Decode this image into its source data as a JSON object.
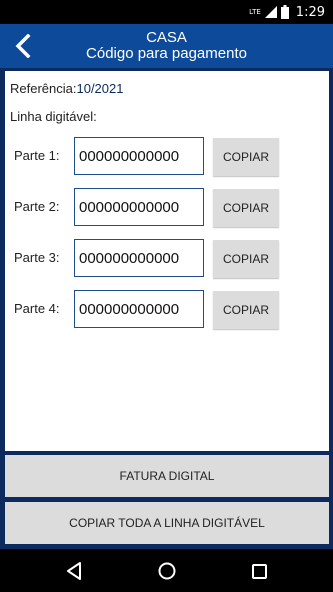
{
  "status_bar": {
    "network": "LTE",
    "time": "1:29"
  },
  "header": {
    "title": "CASA",
    "subtitle": "Código para pagamento"
  },
  "referencia": {
    "label": "Referência:",
    "value": "10/2021"
  },
  "linha_digitavel_label": "Linha digitável:",
  "partes": [
    {
      "label": "Parte 1:",
      "value": "000000000000",
      "button": "COPIAR"
    },
    {
      "label": "Parte 2:",
      "value": "000000000000",
      "button": "COPIAR"
    },
    {
      "label": "Parte 3:",
      "value": "000000000000",
      "button": "COPIAR"
    },
    {
      "label": "Parte 4:",
      "value": "000000000000",
      "button": "COPIAR"
    }
  ],
  "buttons": {
    "fatura_digital": "FATURA DIGITAL",
    "copiar_toda": "COPIAR TODA A LINHA DIGITÁVEL"
  },
  "icons": {
    "back": "chevron-left-icon",
    "nav_back": "triangle-back-icon",
    "nav_home": "circle-home-icon",
    "nav_recent": "square-recent-icon"
  },
  "colors": {
    "background": "#0d2a5e",
    "header": "#0d4a9a",
    "button": "#dcdcdc",
    "input_border": "#1f4e8c"
  }
}
